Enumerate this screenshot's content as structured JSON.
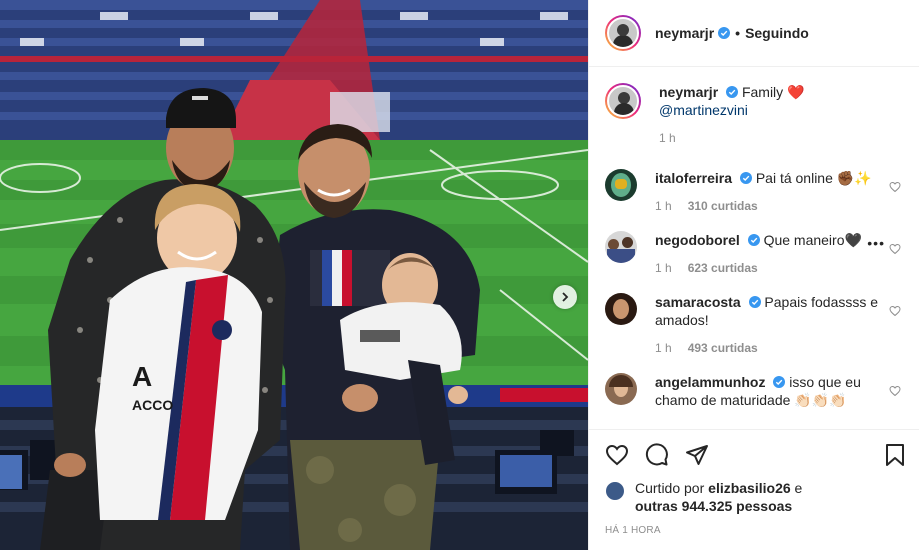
{
  "post": {
    "author": "neymarjr",
    "follow_status": "Seguindo",
    "caption_text": "Family",
    "caption_emoji": "❤️",
    "caption_mention": "@martinezvini",
    "caption_time": "1 h"
  },
  "comments": [
    {
      "user": "italoferreira",
      "text": "Pai tá online ✊🏾✨",
      "time": "1 h",
      "likes": "310 curtidas"
    },
    {
      "user": "negodoborel",
      "text": "Que maneiro🖤",
      "time": "1 h",
      "likes": "623 curtidas"
    },
    {
      "user": "samaracosta",
      "text": "Papais fodassss e amados!",
      "time": "1 h",
      "likes": "493 curtidas"
    },
    {
      "user": "angelammunhoz",
      "text": "isso que eu chamo de maturidade 👏🏻👏🏻👏🏻",
      "time": "",
      "likes": ""
    }
  ],
  "likes_summary": {
    "prefix": "Curtido por",
    "user": "elizbasilio26",
    "connector": "e",
    "others": "outras 944.325 pessoas"
  },
  "time_ago": "HÁ 1 HORA",
  "icons": {
    "verified": "verified-badge-icon",
    "heart": "heart-icon",
    "comment": "comment-icon",
    "share": "share-icon",
    "save": "bookmark-icon",
    "next": "chevron-right-icon"
  },
  "colors": {
    "verified": "#3897f0",
    "heart_red": "#ed4956",
    "mention": "#00376b",
    "muted": "#8e8e8e"
  }
}
